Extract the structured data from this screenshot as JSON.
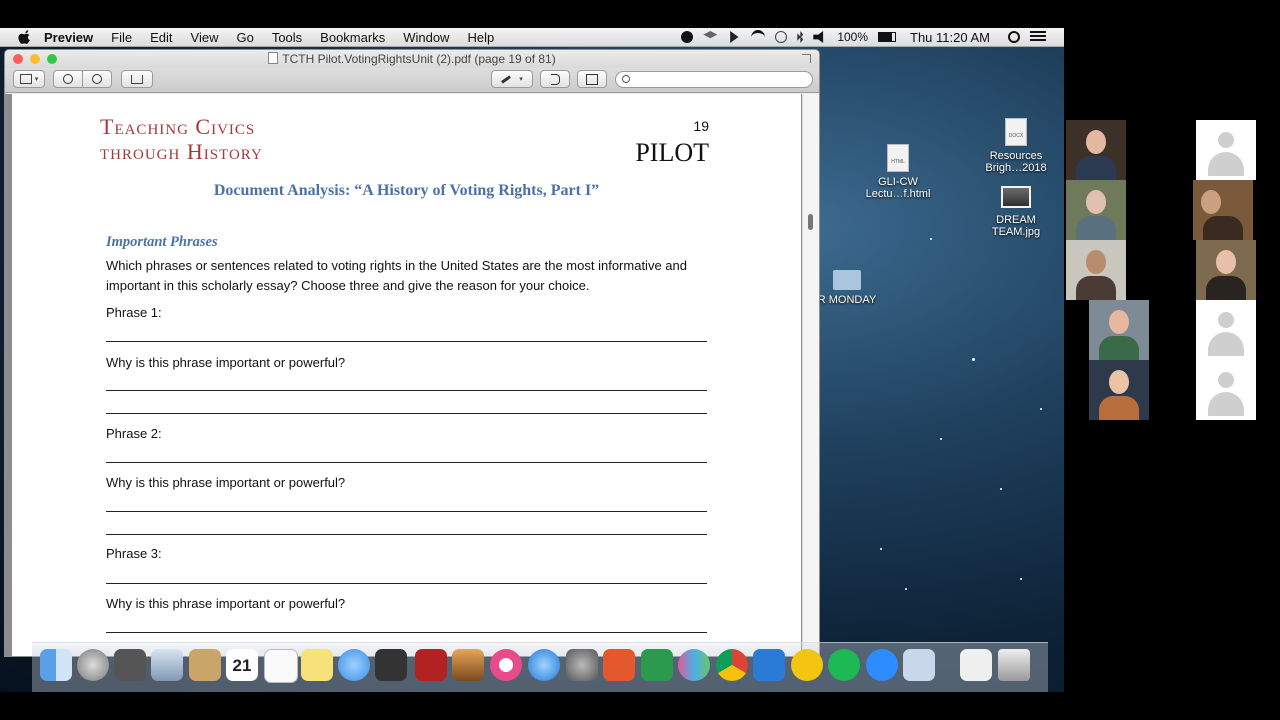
{
  "menubar": {
    "app_name": "Preview",
    "menus": [
      "File",
      "Edit",
      "View",
      "Go",
      "Tools",
      "Bookmarks",
      "Window",
      "Help"
    ],
    "battery": "100%",
    "clock": "Thu 11:20 AM"
  },
  "window": {
    "title": "TCTH Pilot.VotingRightsUnit (2).pdf (page 19 of 81)",
    "search_placeholder": ""
  },
  "page": {
    "logo_line1": "Teaching Civics",
    "logo_line2": "through History",
    "page_number": "19",
    "badge": "PILOT",
    "title": "Document Analysis: “A History of Voting Rights, Part I”",
    "section_heading": "Important Phrases",
    "instructions": "Which phrases or sentences related to voting rights in the United States are the most informative and important in this scholarly essay? Choose three and give the reason for your choice.",
    "phrase1_label": "Phrase 1:",
    "why1": "Why is this phrase important or powerful?",
    "phrase2_label": "Phrase 2:",
    "why2": "Why is this phrase important or powerful?",
    "phrase3_label": "Phrase 3:",
    "why3": "Why is this phrase important or powerful?"
  },
  "desktop_icons": [
    {
      "label": "GLI-CW Lectu…f.html",
      "badge": "HTML"
    },
    {
      "label": "Resources Brigh…2018",
      "badge": "DOCX"
    },
    {
      "label": "DREAM TEAM.jpg"
    },
    {
      "label": "R MONDAY"
    }
  ],
  "dock_apps": [
    "finder",
    "launchpad",
    "image-capture",
    "preview",
    "contacts",
    "calendar",
    "reminders",
    "notes",
    "messages",
    "facetime",
    "photo-booth",
    "iphoto",
    "itunes",
    "app-store",
    "system-preferences",
    "powerpoint",
    "excel",
    "people",
    "chrome",
    "word",
    "outlook",
    "spotify",
    "zoom",
    "preview-2",
    "downloads",
    "trash"
  ],
  "dock_calendar_day": "21",
  "participants": [
    {
      "type": "video",
      "name": "participant-1"
    },
    {
      "type": "avatar",
      "name": "participant-2"
    },
    {
      "type": "video",
      "name": "participant-3"
    },
    {
      "type": "video",
      "name": "participant-4"
    },
    {
      "type": "video",
      "name": "participant-5"
    },
    {
      "type": "video",
      "name": "participant-6"
    },
    {
      "type": "video",
      "name": "participant-7"
    },
    {
      "type": "avatar",
      "name": "participant-8"
    },
    {
      "type": "video",
      "name": "participant-9"
    },
    {
      "type": "avatar",
      "name": "participant-10"
    }
  ],
  "colors": {
    "logo_red": "#a33a3a",
    "heading_blue": "#4a72a8",
    "close": "#fc5f57",
    "minimize": "#fdbc2e",
    "zoom": "#33c748"
  }
}
